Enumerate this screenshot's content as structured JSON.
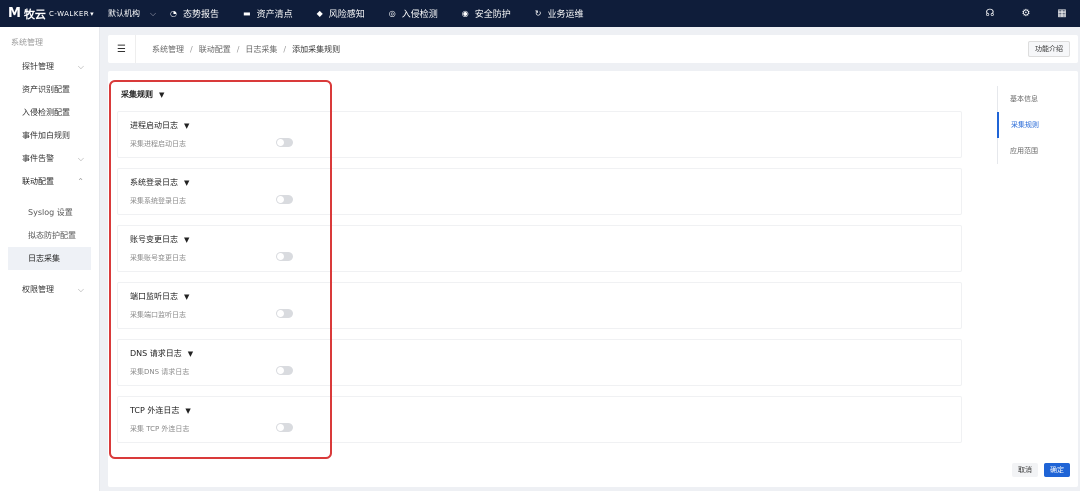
{
  "topbar": {
    "logo_mark": "M",
    "logo_cn": "牧云",
    "logo_en": "C-WALKER",
    "org_label": "默认机构",
    "nav": [
      {
        "icon": "◔",
        "icon_name": "dashboard-icon",
        "label": "态势报告"
      },
      {
        "icon": "▬",
        "icon_name": "asset-icon",
        "label": "资产清点"
      },
      {
        "icon": "◆",
        "icon_name": "risk-shield-icon",
        "label": "风险感知"
      },
      {
        "icon": "◎",
        "icon_name": "globe-icon",
        "label": "入侵检测"
      },
      {
        "icon": "◉",
        "icon_name": "security-shield-icon",
        "label": "安全防护"
      },
      {
        "icon": "↻",
        "icon_name": "operations-icon",
        "label": "业务运维"
      }
    ],
    "right_icons": [
      "headset-icon",
      "gear-icon",
      "apps-grid-icon"
    ]
  },
  "sidebar": {
    "title": "系统管理",
    "items": [
      {
        "label": "探针管理",
        "chevron": "⌵"
      },
      {
        "label": "资产识别配置"
      },
      {
        "label": "入侵检测配置"
      },
      {
        "label": "事件加白规则"
      },
      {
        "label": "事件告警",
        "chevron": "⌵"
      },
      {
        "label": "联动配置",
        "chevron": "⌃"
      }
    ],
    "sub_items": [
      {
        "label": "Syslog 设置"
      },
      {
        "label": "拟态防护配置"
      },
      {
        "label": "日志采集"
      }
    ],
    "after_items": [
      {
        "label": "权限管理",
        "chevron": "⌵"
      }
    ]
  },
  "breadcrumb": {
    "items": [
      "系统管理",
      "联动配置",
      "日志采集",
      "添加采集规则"
    ],
    "separator": "/",
    "intro_button": "功能介绍"
  },
  "main": {
    "section_title": "采集规则",
    "cards": [
      {
        "title": "进程启动日志",
        "desc": "采集进程启动日志",
        "enabled": false
      },
      {
        "title": "系统登录日志",
        "desc": "采集系统登录日志",
        "enabled": false
      },
      {
        "title": "账号变更日志",
        "desc": "采集账号变更日志",
        "enabled": false
      },
      {
        "title": "端口监听日志",
        "desc": "采集端口监听日志",
        "enabled": false
      },
      {
        "title": "DNS 请求日志",
        "desc": "采集DNS 请求日志",
        "enabled": false
      },
      {
        "title": "TCP 外连日志",
        "desc": "采集 TCP 外连日志",
        "enabled": false
      }
    ],
    "anchor": [
      "基本信息",
      "采集规则",
      "应用范围"
    ],
    "actions": {
      "cancel": "取消",
      "ok": "确定"
    }
  },
  "colors": {
    "topbar": "#0f1d3a",
    "accent": "#1f64d6",
    "highlight": "#d93a3a"
  }
}
